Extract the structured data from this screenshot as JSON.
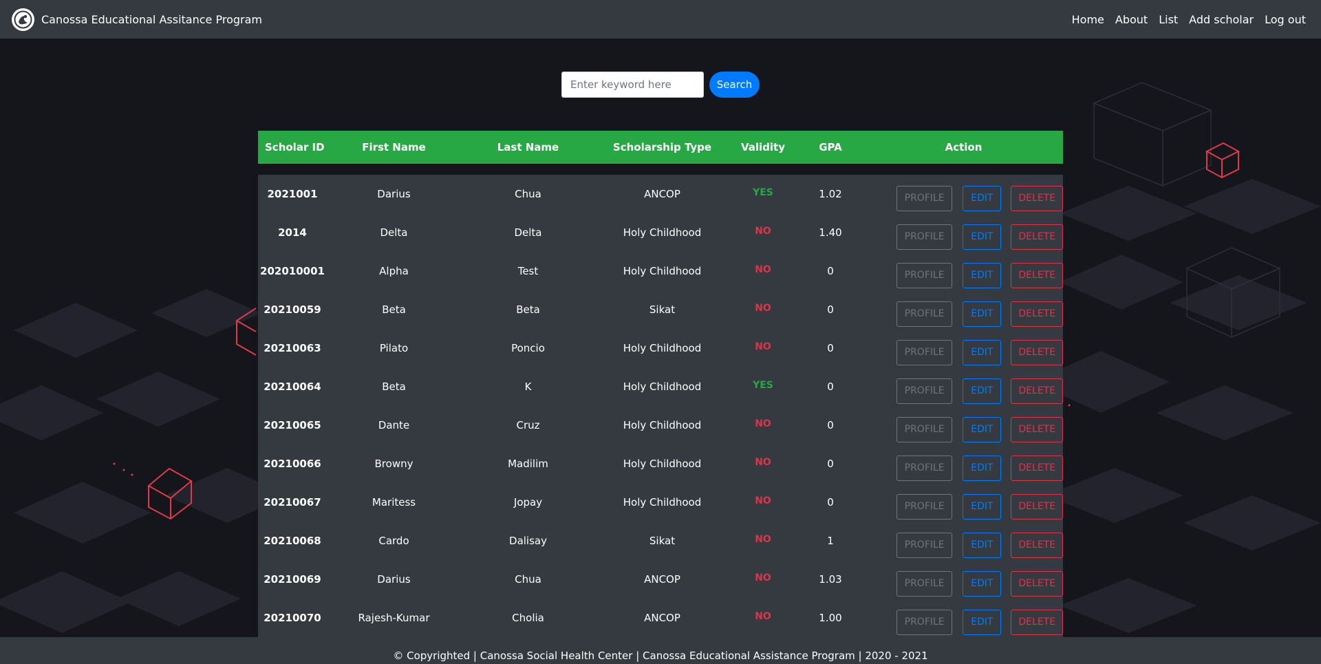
{
  "navbar": {
    "brand": "Canossa Educational Assitance Program",
    "links": [
      "Home",
      "About",
      "List",
      "Add scholar",
      "Log out"
    ]
  },
  "search": {
    "placeholder": "Enter keyword here",
    "button": "Search"
  },
  "table": {
    "headers": [
      "Scholar ID",
      "First Name",
      "Last Name",
      "Scholarship Type",
      "Validity",
      "GPA",
      "Action"
    ],
    "rows": [
      {
        "id": "2021001",
        "first": "Darius",
        "last": "Chua",
        "type": "ANCOP",
        "validity": "YES",
        "gpa": "1.02"
      },
      {
        "id": "2014",
        "first": "Delta",
        "last": "Delta",
        "type": "Holy Childhood",
        "validity": "NO",
        "gpa": "1.40"
      },
      {
        "id": "202010001",
        "first": "Alpha",
        "last": "Test",
        "type": "Holy Childhood",
        "validity": "NO",
        "gpa": "0"
      },
      {
        "id": "20210059",
        "first": "Beta",
        "last": "Beta",
        "type": "Sikat",
        "validity": "NO",
        "gpa": "0"
      },
      {
        "id": "20210063",
        "first": "Pilato",
        "last": "Poncio",
        "type": "Holy Childhood",
        "validity": "NO",
        "gpa": "0"
      },
      {
        "id": "20210064",
        "first": "Beta",
        "last": "K",
        "type": "Holy Childhood",
        "validity": "YES",
        "gpa": "0"
      },
      {
        "id": "20210065",
        "first": "Dante",
        "last": "Cruz",
        "type": "Holy Childhood",
        "validity": "NO",
        "gpa": "0"
      },
      {
        "id": "20210066",
        "first": "Browny",
        "last": "Madilim",
        "type": "Holy Childhood",
        "validity": "NO",
        "gpa": "0"
      },
      {
        "id": "20210067",
        "first": "Maritess",
        "last": "Jopay",
        "type": "Holy Childhood",
        "validity": "NO",
        "gpa": "0"
      },
      {
        "id": "20210068",
        "first": "Cardo",
        "last": "Dalisay",
        "type": "Sikat",
        "validity": "NO",
        "gpa": "1"
      },
      {
        "id": "20210069",
        "first": "Darius",
        "last": "Chua",
        "type": "ANCOP",
        "validity": "NO",
        "gpa": "1.03"
      },
      {
        "id": "20210070",
        "first": "Rajesh-Kumar",
        "last": "Cholia",
        "type": "ANCOP",
        "validity": "NO",
        "gpa": "1.00"
      }
    ],
    "actions": {
      "profile": "PROFILE",
      "edit": "EDIT",
      "delete": "DELETE"
    }
  },
  "footer": {
    "text": "© Copyrighted | Canossa Social Health Center | Canossa Educational Assistance Program | 2020 - 2021"
  },
  "colors": {
    "navbar": "#343a40",
    "header": "#28a745",
    "yes": "#28a745",
    "no": "#dc3545",
    "search_button": "#007bff"
  }
}
